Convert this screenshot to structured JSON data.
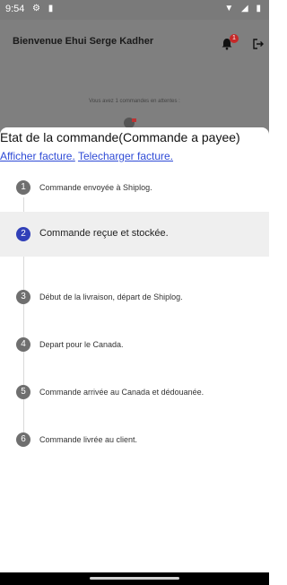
{
  "status_bar": {
    "time": "9:54"
  },
  "header": {
    "title": "Bienvenue Ehui Serge Kadher",
    "notification_count": "1"
  },
  "background": {
    "pending_text": "Vous avez 1 commandes en attentes :"
  },
  "sheet": {
    "title": "Etat de la commande(Commande a payee)",
    "show_invoice": "Afficher facture.",
    "download_invoice": "Telecharger facture.",
    "steps": [
      {
        "number": "1",
        "label": "Commande envoyée à Shiplog."
      },
      {
        "number": "2",
        "label": "Commande reçue et stockée."
      },
      {
        "number": "3",
        "label": "Début de la livraison, départ de Shiplog."
      },
      {
        "number": "4",
        "label": "Depart pour le Canada."
      },
      {
        "number": "5",
        "label": "Commande arrivée au Canada et dédouanée."
      },
      {
        "number": "6",
        "label": "Commande livrée au client."
      }
    ]
  },
  "colors": {
    "active_step": "#3140b8",
    "inactive_step": "#6f6f6f",
    "link": "#2f4bd6",
    "badge": "#c62828"
  }
}
